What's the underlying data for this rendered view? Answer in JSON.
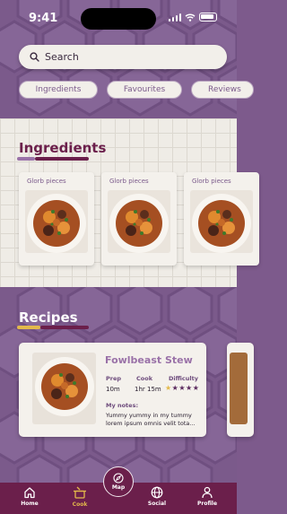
{
  "status_bar": {
    "time": "9:41"
  },
  "search": {
    "placeholder": "Search"
  },
  "chips": [
    "Ingredients",
    "Favourites",
    "Reviews"
  ],
  "ingredients_section": {
    "title": "Ingredients",
    "cards": [
      {
        "name": "Glorb pieces"
      },
      {
        "name": "Glorb pieces"
      },
      {
        "name": "Glorb pieces"
      }
    ]
  },
  "recipes_section": {
    "title": "Recipes",
    "card": {
      "title": "Fowlbeast Stew",
      "prep_label": "Prep",
      "prep_value": "10m",
      "cook_label": "Cook",
      "cook_value": "1hr 15m",
      "difficulty_label": "Difficulty",
      "difficulty_level": "1 of 5",
      "notes_label": "My notes:",
      "notes": "Yummy yummy in my tummy lorem ipsum omnis velit tota..."
    }
  },
  "nav": {
    "home": "Home",
    "cook": "Cook",
    "map": "Map",
    "social": "Social",
    "profile": "Profile"
  },
  "colors": {
    "brand_purple": "#7b5a8b",
    "nav_maroon": "#6b1f4b",
    "accent_gold": "#e3b94b"
  }
}
